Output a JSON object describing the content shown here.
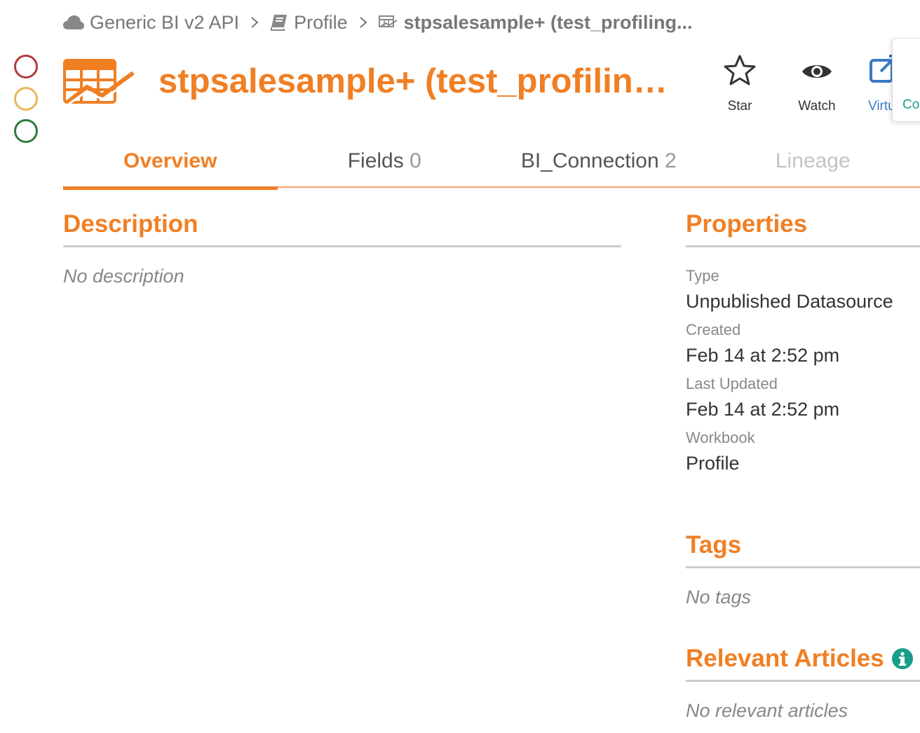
{
  "colors": {
    "accent": "#f07f24",
    "status_red": "#b23b3b",
    "status_yellow": "#e9b55c",
    "status_green": "#2f7a3a",
    "link_blue": "#3a79c5",
    "teal": "#1a9c8c"
  },
  "breadcrumb": {
    "items": [
      {
        "label": "Generic BI v2 API",
        "icon": "cloud-icon"
      },
      {
        "label": "Profile",
        "icon": "book-icon"
      },
      {
        "label": "stpsalesample+ (test_profiling...",
        "icon": "datasource-icon"
      }
    ]
  },
  "header": {
    "title": "stpsalesample+ (test_profiling_...",
    "icon": "datasource-icon",
    "actions": [
      {
        "label": "Star",
        "icon": "star-icon"
      },
      {
        "label": "Watch",
        "icon": "eye-icon"
      },
      {
        "label": "Virtua",
        "icon": "external-edit-icon"
      }
    ],
    "side_panel_label": "Co"
  },
  "tabs": [
    {
      "label": "Overview",
      "count": "",
      "active": true
    },
    {
      "label": "Fields",
      "count": "0"
    },
    {
      "label": "BI_Connection",
      "count": "2"
    },
    {
      "label": "Lineage",
      "count": "",
      "disabled": true
    }
  ],
  "description": {
    "title": "Description",
    "empty_text": "No description"
  },
  "properties": {
    "title": "Properties",
    "type_label": "Type",
    "type_value": "Unpublished Datasource",
    "created_label": "Created",
    "created_value": "Feb 14 at 2:52 pm",
    "updated_label": "Last Updated",
    "updated_value": "Feb 14 at 2:52 pm",
    "workbook_label": "Workbook",
    "workbook_value": "Profile"
  },
  "tags": {
    "title": "Tags",
    "empty_text": "No tags"
  },
  "articles": {
    "title": "Relevant Articles",
    "empty_text": "No relevant articles",
    "info_icon": "info-icon"
  }
}
